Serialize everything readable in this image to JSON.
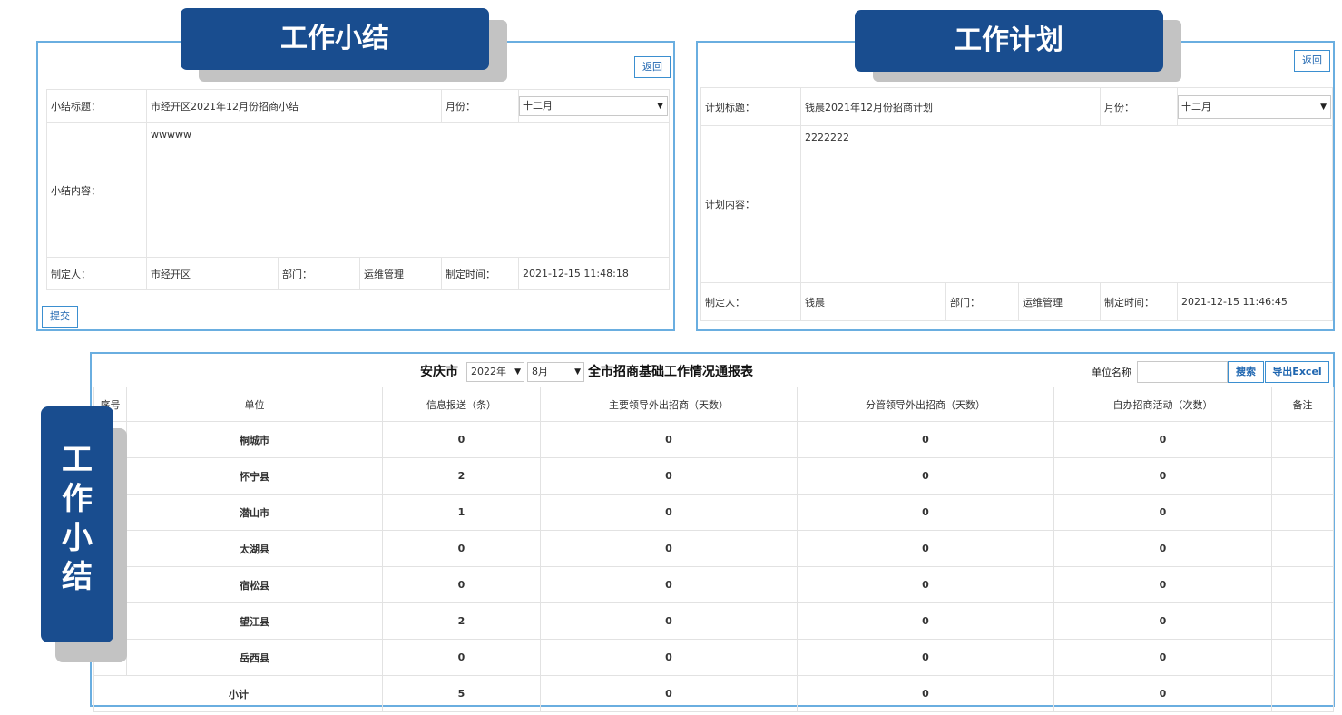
{
  "summary_panel": {
    "badge": "工作小结",
    "back_label": "返回",
    "title_label": "小结标题：",
    "title_value": "市经开区2021年12月份招商小结",
    "month_label": "月份：",
    "month_value": "十二月",
    "content_label": "小结内容：",
    "content_value": "wwwww",
    "maker_label": "制定人：",
    "maker_value": "市经开区",
    "dept_label": "部门：",
    "dept_value": "运维管理",
    "time_label": "制定时间：",
    "time_value": "2021-12-15 11:48:18",
    "submit_label": "提交"
  },
  "plan_panel": {
    "badge": "工作计划",
    "back_label": "返回",
    "title_label": "计划标题：",
    "title_value": "钱晨2021年12月份招商计划",
    "month_label": "月份：",
    "month_value": "十二月",
    "content_label": "计划内容：",
    "content_value": "2222222",
    "maker_label": "制定人：",
    "maker_value": "钱晨",
    "dept_label": "部门：",
    "dept_value": "运维管理",
    "time_label": "制定时间：",
    "time_value": "2021-12-15 11:46:45"
  },
  "report": {
    "city": "安庆市",
    "year": "2022年",
    "month": "8月",
    "title": "全市招商基础工作情况通报表",
    "unit_label": "单位名称",
    "unit_placeholder": "",
    "search_label": "搜索",
    "export_label": "导出Excel",
    "headers": [
      "序号",
      "单位",
      "信息报送（条）",
      "主要领导外出招商（天数）",
      "分管领导外出招商（天数）",
      "自办招商活动（次数）",
      "备注"
    ],
    "rows": [
      {
        "index": "",
        "unit": "桐城市",
        "info": "0",
        "main_leader": "0",
        "deputy_leader": "0",
        "events": "0",
        "note": ""
      },
      {
        "index": "",
        "unit": "怀宁县",
        "info": "2",
        "main_leader": "0",
        "deputy_leader": "0",
        "events": "0",
        "note": ""
      },
      {
        "index": "",
        "unit": "潜山市",
        "info": "1",
        "main_leader": "0",
        "deputy_leader": "0",
        "events": "0",
        "note": ""
      },
      {
        "index": "",
        "unit": "太湖县",
        "info": "0",
        "main_leader": "0",
        "deputy_leader": "0",
        "events": "0",
        "note": ""
      },
      {
        "index": "",
        "unit": "宿松县",
        "info": "0",
        "main_leader": "0",
        "deputy_leader": "0",
        "events": "0",
        "note": ""
      },
      {
        "index": "",
        "unit": "望江县",
        "info": "2",
        "main_leader": "0",
        "deputy_leader": "0",
        "events": "0",
        "note": ""
      },
      {
        "index": "",
        "unit": "岳西县",
        "info": "0",
        "main_leader": "0",
        "deputy_leader": "0",
        "events": "0",
        "note": ""
      }
    ],
    "subtotal": {
      "label": "小计",
      "info": "5",
      "main_leader": "0",
      "deputy_leader": "0",
      "events": "0",
      "note": ""
    }
  },
  "side_badge": [
    "工",
    "作",
    "小",
    "结"
  ],
  "colors": {
    "badge_blue": "#194d8f",
    "panel_border": "#6aaee0",
    "badge_shadow": "#c3c3c3",
    "button_text": "#1f66b0"
  }
}
